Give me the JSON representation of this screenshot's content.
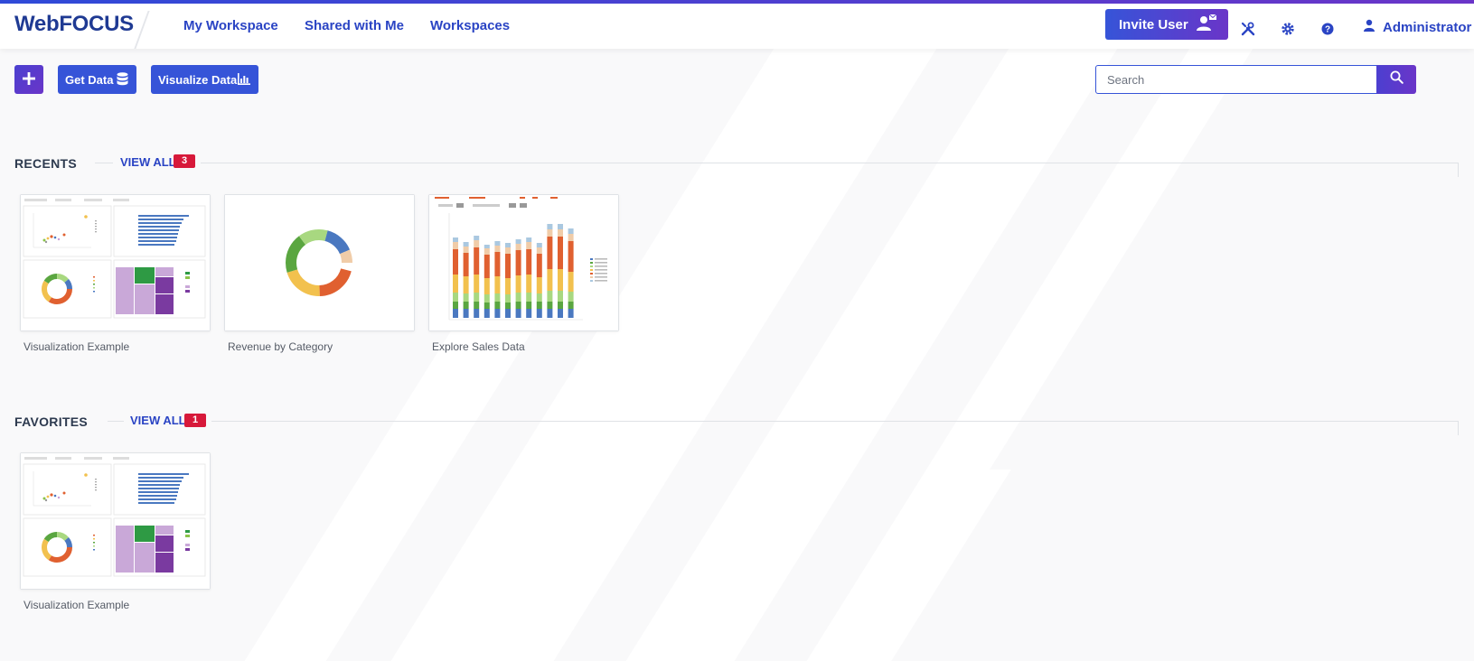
{
  "header": {
    "logo": "WebFOCUS",
    "nav": [
      {
        "label": "My Workspace"
      },
      {
        "label": "Shared with Me"
      },
      {
        "label": "Workspaces"
      }
    ],
    "invite_label": "Invite User",
    "user_label": "Administrator"
  },
  "toolbar": {
    "plus_label": "+",
    "get_data_label": "Get Data",
    "visualize_label": "Visualize Data",
    "search_placeholder": "Search"
  },
  "recents": {
    "title": "RECENTS",
    "view_all": "VIEW ALL",
    "count": "3",
    "items": [
      {
        "label": "Visualization Example"
      },
      {
        "label": "Revenue by Category"
      },
      {
        "label": "Explore Sales Data"
      }
    ]
  },
  "favorites": {
    "title": "FAVORITES",
    "view_all": "VIEW ALL",
    "count": "1",
    "items": [
      {
        "label": "Visualization Example"
      }
    ]
  },
  "colors": {
    "brand": "#1f3a93",
    "accent": "#3654d8",
    "badge": "#d7193a"
  }
}
